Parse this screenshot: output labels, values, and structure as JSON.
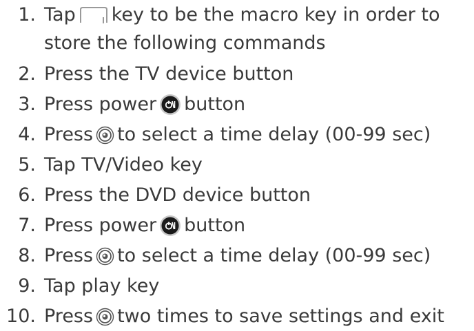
{
  "steps": [
    {
      "num": "1.",
      "before": "Tap",
      "icon": "macro-key-icon",
      "after": "key to be the macro key in order to",
      "continuation": "store the following commands"
    },
    {
      "num": "2.",
      "text": "Press the TV device button"
    },
    {
      "num": "3.",
      "before": "Press power",
      "icon": "power-button-icon",
      "after": "button"
    },
    {
      "num": "4.",
      "before": "Press",
      "icon": "dial-icon",
      "after": "to select a time delay (00-99 sec)"
    },
    {
      "num": "5.",
      "text": "Tap TV/Video key"
    },
    {
      "num": "6.",
      "text": "Press the DVD device button"
    },
    {
      "num": "7.",
      "before": "Press power",
      "icon": "power-button-icon",
      "after": "button"
    },
    {
      "num": "8.",
      "before": "Press",
      "icon": "dial-icon",
      "after": "to select a time delay (00-99 sec)"
    },
    {
      "num": "9.",
      "text": "Tap play key"
    },
    {
      "num": "10.",
      "before": "Press",
      "icon": "dial-icon",
      "after": "two times to save settings and exit"
    }
  ],
  "colors": {
    "text": "#3a3a3a",
    "power_button_fill": "#1a1a1a",
    "power_button_ring": "#c8c8c8"
  }
}
